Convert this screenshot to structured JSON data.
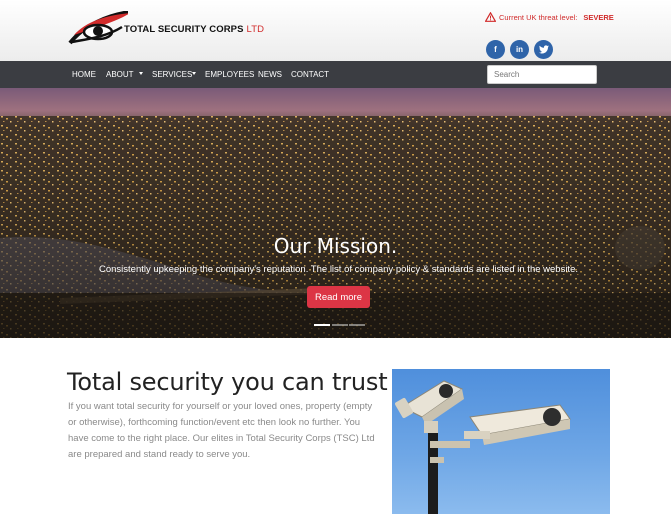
{
  "brand": {
    "name": "TOTAL SECURITY CORPS",
    "suffix": "LTD",
    "accent": "#d12b2b"
  },
  "threat": {
    "label": "Current UK threat level:",
    "level": "SEVERE",
    "icon": "warning-triangle-icon"
  },
  "social": [
    {
      "label": "f",
      "icon": "facebook-icon"
    },
    {
      "label": "in",
      "icon": "linkedin-icon"
    },
    {
      "label": "t",
      "icon": "twitter-icon"
    }
  ],
  "nav": {
    "items": [
      "HOME",
      "ABOUT",
      "SERVICES",
      "EMPLOYEES",
      "NEWS",
      "CONTACT"
    ],
    "search_placeholder": "Search",
    "background": "#3b3d42"
  },
  "hero": {
    "title": "Our Mission.",
    "subtitle": "Consistently upkeeping the company's reputation. The list of company policy & standards are listed in the website.",
    "button": "Read more",
    "button_color": "#dc3545",
    "slides": 3,
    "active_slide": 1
  },
  "content": {
    "title": "Total security you can trust",
    "body": "If you want total security for yourself or your loved ones, property (empty or otherwise), forthcoming function/event etc then look no further. You have come to the right place. Our elites in Total Security Corps (TSC) Ltd are prepared and stand ready to serve you."
  }
}
